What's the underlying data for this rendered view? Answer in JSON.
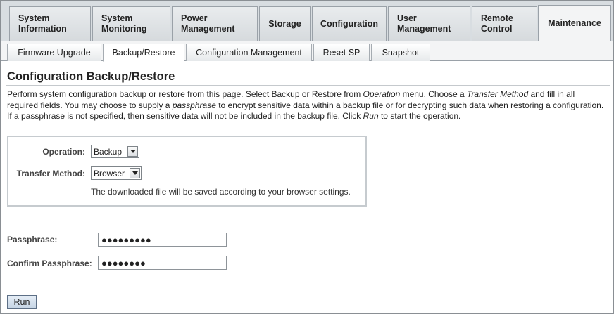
{
  "main_tabs": [
    {
      "label": "System\nInformation"
    },
    {
      "label": "System\nMonitoring"
    },
    {
      "label": "Power\nManagement"
    },
    {
      "label": "Storage"
    },
    {
      "label": "Configuration"
    },
    {
      "label": "User\nManagement"
    },
    {
      "label": "Remote\nControl"
    },
    {
      "label": "Maintenance",
      "active": true
    }
  ],
  "sub_tabs": [
    {
      "label": "Firmware Upgrade"
    },
    {
      "label": "Backup/Restore",
      "active": true
    },
    {
      "label": "Configuration Management"
    },
    {
      "label": "Reset SP"
    },
    {
      "label": "Snapshot"
    }
  ],
  "page": {
    "title": "Configuration Backup/Restore",
    "description": {
      "p1": "Perform system configuration backup or restore from this page. Select Backup or Restore from ",
      "i1": "Operation",
      "p2": " menu. Choose a ",
      "i2": "Transfer Method",
      "p3": " and fill in all required fields. You may choose to supply a ",
      "i3": "passphrase",
      "p4": " to encrypt sensitive data within a backup file or for decrypting such data when restoring a configuration. If a passphrase is not specified, then sensitive data will not be included in the backup file. Click ",
      "i4": "Run",
      "p5": " to start the operation."
    }
  },
  "form": {
    "operation_label": "Operation:",
    "operation_value": "Backup",
    "transfer_label": "Transfer Method:",
    "transfer_value": "Browser",
    "note": "The downloaded file will be saved according to your browser settings.",
    "passphrase_label": "Passphrase:",
    "passphrase_value": "●●●●●●●●●",
    "confirm_label": "Confirm Passphrase:",
    "confirm_value": "●●●●●●●●",
    "run_label": "Run"
  },
  "icons": {
    "dropdown": "chevron-down-icon"
  }
}
